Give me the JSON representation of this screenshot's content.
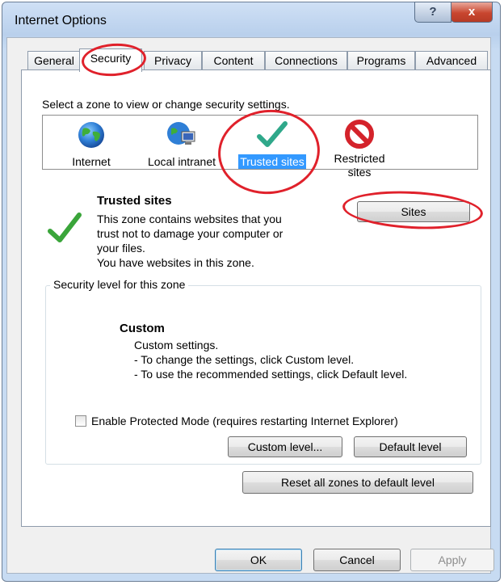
{
  "window": {
    "title": "Internet Options",
    "help_glyph": "?",
    "close_glyph": "x"
  },
  "tabs": [
    "General",
    "Security",
    "Privacy",
    "Content",
    "Connections",
    "Programs",
    "Advanced"
  ],
  "active_tab": "Security",
  "zones": {
    "prompt": "Select a zone to view or change security settings.",
    "items": [
      {
        "label": "Internet",
        "icon": "globe-icon"
      },
      {
        "label": "Local intranet",
        "icon": "intranet-icon"
      },
      {
        "label": "Trusted sites",
        "icon": "checkmark-icon",
        "selected": true
      },
      {
        "label": "Restricted sites",
        "label_line1": "Restricted",
        "label_line2": "sites",
        "icon": "prohibited-icon"
      }
    ]
  },
  "zone_info": {
    "title": "Trusted sites",
    "desc1": "This zone contains websites that you",
    "desc2": "trust not to damage your computer or",
    "desc3": "your files.",
    "desc4": "You have websites in this zone.",
    "sites_button": "Sites"
  },
  "security_level": {
    "group_label": "Security level for this zone",
    "level_name": "Custom",
    "line1": "Custom settings.",
    "line2": "- To change the settings, click Custom level.",
    "line3": "- To use the recommended settings, click Default level.",
    "protected_mode_label": "Enable Protected Mode (requires restarting Internet Explorer)",
    "protected_mode_checked": false,
    "custom_level_button": "Custom level...",
    "default_level_button": "Default level",
    "reset_all_button": "Reset all zones to default level"
  },
  "footer": {
    "ok": "OK",
    "cancel": "Cancel",
    "apply": "Apply"
  },
  "colors": {
    "selection": "#3399ff",
    "annotation_red": "#e0212b",
    "check_green": "#3aa53a"
  }
}
